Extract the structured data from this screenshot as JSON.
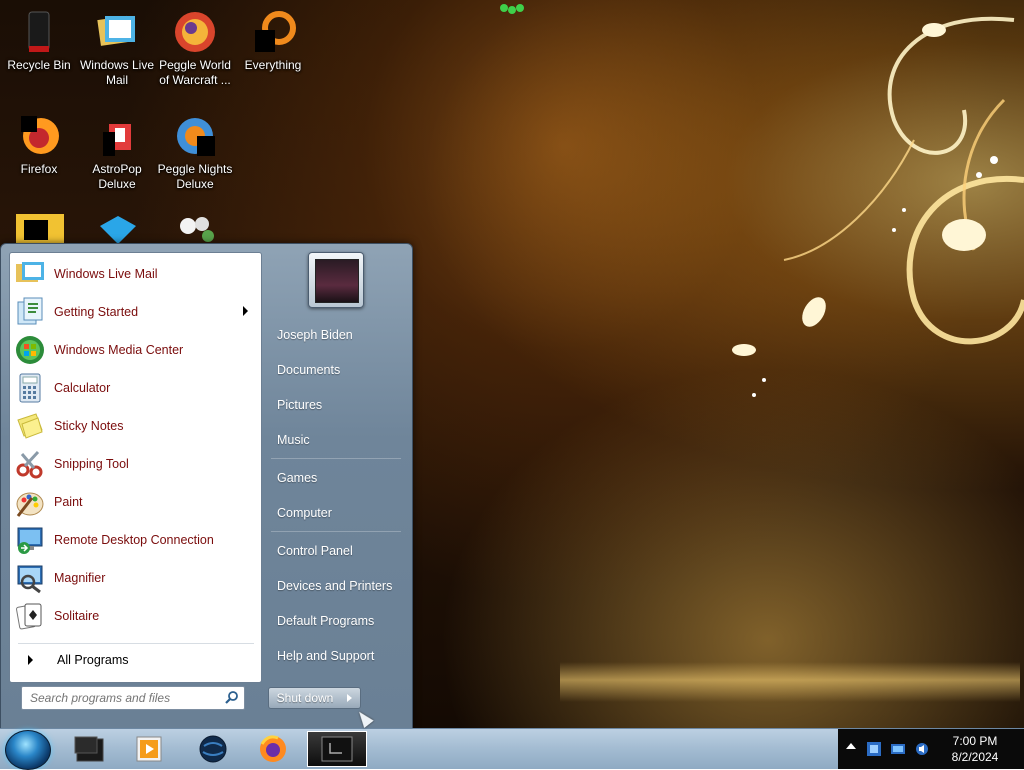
{
  "desktop_icons": [
    {
      "label": "Recycle Bin",
      "icon": "recycle-bin-icon"
    },
    {
      "label": "Windows Live Mail",
      "icon": "mail-icon"
    },
    {
      "label": "Peggle World of Warcraft ...",
      "icon": "peggle-icon"
    },
    {
      "label": "Everything",
      "icon": "everything-icon"
    },
    {
      "label": "Firefox",
      "icon": "firefox-icon"
    },
    {
      "label": "AstroPop Deluxe",
      "icon": "astropop-icon"
    },
    {
      "label": "Peggle Nights Deluxe",
      "icon": "peggle-nights-icon"
    }
  ],
  "start_menu": {
    "pinned": [
      {
        "label": "Windows Live Mail",
        "icon": "mail-icon"
      },
      {
        "label": "Getting Started",
        "icon": "getting-started-icon",
        "has_submenu": true
      },
      {
        "label": "Windows Media Center",
        "icon": "media-center-icon"
      },
      {
        "label": "Calculator",
        "icon": "calculator-icon"
      },
      {
        "label": "Sticky Notes",
        "icon": "sticky-notes-icon"
      },
      {
        "label": "Snipping Tool",
        "icon": "scissors-icon"
      },
      {
        "label": "Paint",
        "icon": "paint-palette-icon"
      },
      {
        "label": "Remote Desktop Connection",
        "icon": "remote-desktop-icon"
      },
      {
        "label": "Magnifier",
        "icon": "magnifier-icon"
      },
      {
        "label": "Solitaire",
        "icon": "cards-icon"
      }
    ],
    "all_programs": "All Programs",
    "search_placeholder": "Search programs and files",
    "right_items": [
      {
        "label": "Joseph Biden"
      },
      {
        "label": "Documents"
      },
      {
        "label": "Pictures"
      },
      {
        "label": "Music"
      },
      {
        "label": "Games"
      },
      {
        "label": "Computer"
      },
      {
        "label": "Control Panel"
      },
      {
        "label": "Devices and Printers"
      },
      {
        "label": "Default Programs"
      },
      {
        "label": "Help and Support"
      }
    ],
    "shutdown_label": "Shut down"
  },
  "taskbar": {
    "pinned": [
      "explorer-icon",
      "media-player-icon",
      "globe-icon",
      "firefox-icon",
      "terminal-icon"
    ],
    "clock_time": "7:00 PM",
    "clock_date": "8/2/2024"
  }
}
